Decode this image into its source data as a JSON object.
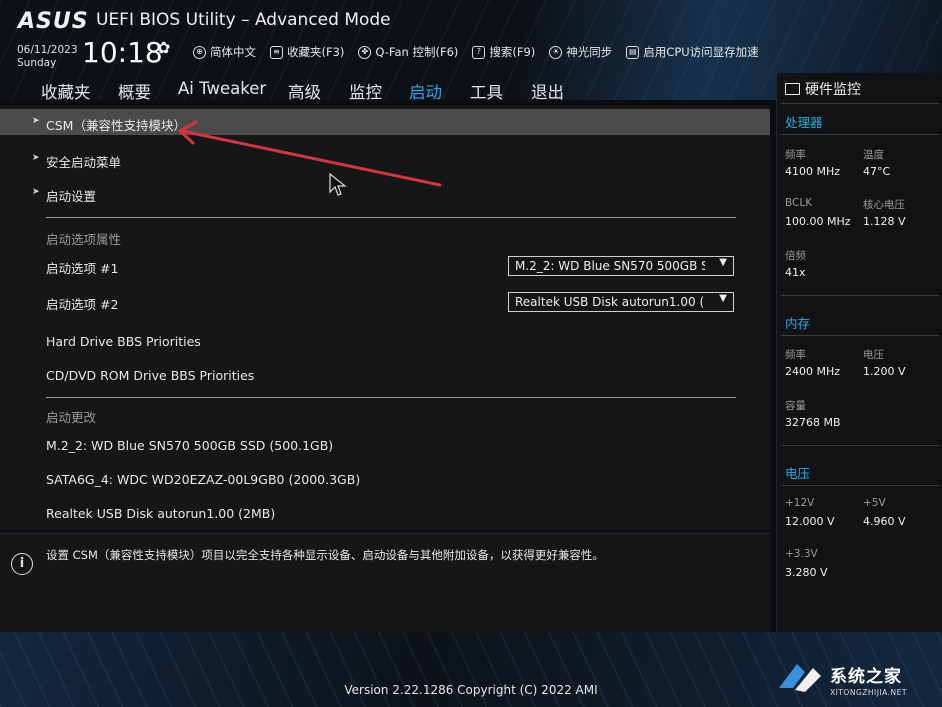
{
  "header": {
    "logo": "ASUS",
    "title": "UEFI BIOS Utility – Advanced Mode",
    "date": "06/11/2023",
    "day": "Sunday",
    "time": "10:18",
    "settings_icon": "gear-icon",
    "toolbar": [
      {
        "icon": "globe-icon",
        "label": "简体中文"
      },
      {
        "icon": "favorites-icon",
        "label": "收藏夹(F3)"
      },
      {
        "icon": "fan-icon",
        "label": "Q-Fan 控制(F6)"
      },
      {
        "icon": "help-icon",
        "label": "搜索(F9)"
      },
      {
        "icon": "light-icon",
        "label": "神光同步"
      },
      {
        "icon": "memory-icon",
        "label": "启用CPU访问显存加速"
      }
    ]
  },
  "menu": {
    "tabs": [
      "收藏夹",
      "概要",
      "Ai Tweaker",
      "高级",
      "监控",
      "启动",
      "工具",
      "退出"
    ],
    "active": "启动"
  },
  "main": {
    "items": [
      {
        "label": "CSM（兼容性支持模块）"
      },
      {
        "label": "安全启动菜单"
      },
      {
        "label": "启动设置"
      }
    ],
    "boot_options_header": "启动选项属性",
    "boot_option_1": {
      "label": "启动选项 #1",
      "value": "M.2_2: WD Blue SN570 500GB S"
    },
    "boot_option_2": {
      "label": "启动选项 #2",
      "value": "Realtek USB Disk autorun1.00 (2"
    },
    "hdd_bbs": "Hard Drive BBS Priorities",
    "cd_bbs": "CD/DVD ROM Drive BBS Priorities",
    "boot_override_header": "启动更改",
    "overrides": [
      "M.2_2: WD Blue SN570 500GB SSD (500.1GB)",
      "SATA6G_4: WDC WD20EZAZ-00L9GB0 (2000.3GB)",
      "Realtek USB Disk autorun1.00 (2MB)"
    ]
  },
  "info": {
    "text": "设置 CSM（兼容性支持模块）项目以完全支持各种显示设备、启动设备与其他附加设备，以获得更好兼容性。"
  },
  "monitor": {
    "title": "硬件监控",
    "cpu": {
      "heading": "处理器",
      "freq_label": "频率",
      "freq": "4100 MHz",
      "temp_label": "温度",
      "temp": "47°C",
      "bclk_label": "BCLK",
      "bclk": "100.00 MHz",
      "vcore_label": "核心电压",
      "vcore": "1.128 V",
      "ratio_label": "倍频",
      "ratio": "41x"
    },
    "memory": {
      "heading": "内存",
      "freq_label": "频率",
      "freq": "2400 MHz",
      "volt_label": "电压",
      "volt": "1.200 V",
      "cap_label": "容量",
      "cap": "32768 MB"
    },
    "voltage": {
      "heading": "电压",
      "v12_label": "+12V",
      "v12": "12.000 V",
      "v5_label": "+5V",
      "v5": "4.960 V",
      "v33_label": "+3.3V",
      "v33": "3.280 V"
    }
  },
  "footer": {
    "version": "Version 2.22.1286 Copyright (C) 2022 AMI"
  },
  "watermark": {
    "text": "系统之家",
    "url": "XITONGZHIJIA.NET"
  },
  "colors": {
    "accent": "#2fa8e8",
    "annotation_arrow": "#d8343c"
  }
}
